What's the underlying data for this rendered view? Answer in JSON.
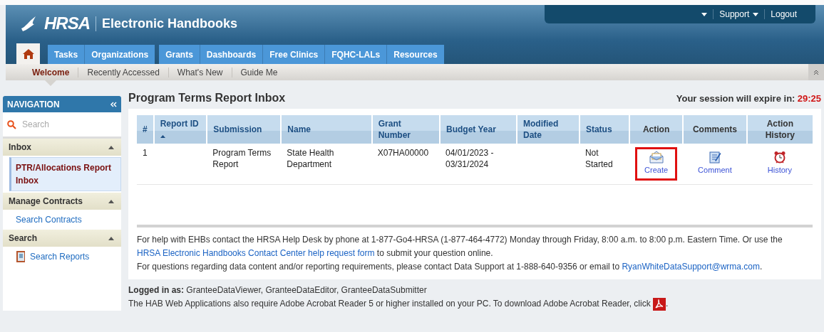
{
  "header": {
    "logo": "HRSA",
    "app_title": "Electronic Handbooks",
    "user_menu": [
      {
        "kind": "dropdown"
      },
      {
        "label": "Support",
        "kind": "dropdown"
      },
      {
        "label": "Logout",
        "kind": "link"
      }
    ]
  },
  "tabs": [
    {
      "kind": "home",
      "selected": true
    },
    {
      "label": "Tasks",
      "kind": "tab",
      "selected": false
    },
    {
      "label": "Organizations",
      "kind": "tab",
      "selected": false
    },
    {
      "label": "Grants",
      "kind": "tab",
      "selected": false
    },
    {
      "label": "Dashboards",
      "kind": "tab",
      "selected": false
    },
    {
      "label": "Free Clinics",
      "kind": "tab",
      "selected": false
    },
    {
      "label": "FQHC-LALs",
      "kind": "tab",
      "selected": false
    },
    {
      "label": "Resources",
      "kind": "tab",
      "selected": false
    }
  ],
  "subnav": [
    {
      "label": "Welcome",
      "selected": true
    },
    {
      "label": "Recently Accessed",
      "selected": false
    },
    {
      "label": "What's New",
      "selected": false
    },
    {
      "label": "Guide Me",
      "selected": false
    }
  ],
  "sidebar": {
    "title": "NAVIGATION",
    "search": {
      "placeholder": "Search"
    },
    "sections": [
      {
        "label": "Inbox",
        "expanded": true,
        "items": [
          {
            "label": "PTR/Allocations Report Inbox",
            "selected": true,
            "kind": "plain"
          }
        ]
      },
      {
        "label": "Manage Contracts",
        "expanded": true,
        "items": [
          {
            "label": "Search Contracts",
            "selected": false,
            "kind": "plain"
          }
        ]
      },
      {
        "label": "Search",
        "expanded": true,
        "items": [
          {
            "label": "Search Reports",
            "selected": false,
            "kind": "report"
          }
        ]
      }
    ]
  },
  "page": {
    "title": "Program Terms Report Inbox",
    "session_label": "Your session will expire in:",
    "session_time": "29:25"
  },
  "table": {
    "columns": [
      {
        "label": "#",
        "sorted": false
      },
      {
        "label": "Report ID",
        "sorted": true
      },
      {
        "label": "Submission",
        "sorted": false
      },
      {
        "label": "Name",
        "sorted": false
      },
      {
        "label": "Grant Number",
        "sorted": false
      },
      {
        "label": "Budget Year",
        "sorted": false
      },
      {
        "label": "Modified Date",
        "sorted": false
      },
      {
        "label": "Status",
        "sorted": false
      },
      {
        "label": "Action",
        "sorted": false
      },
      {
        "label": "Comments",
        "sorted": false
      },
      {
        "label": "Action History",
        "sorted": false
      }
    ],
    "rows": [
      {
        "cells": [
          {
            "kind": "text",
            "text": "1"
          },
          {
            "kind": "text",
            "text": ""
          },
          {
            "kind": "text",
            "text": "Program Terms Report"
          },
          {
            "kind": "text",
            "text": "State Health Department"
          },
          {
            "kind": "text",
            "text": "X07HA00000"
          },
          {
            "kind": "text",
            "text": "04/01/2023 - 03/31/2024"
          },
          {
            "kind": "text",
            "text": ""
          },
          {
            "kind": "text",
            "text": "Not Started"
          },
          {
            "kind": "action",
            "text": "Create",
            "highlighted": true
          },
          {
            "kind": "action",
            "text": "Comment",
            "highlighted": false
          },
          {
            "kind": "action",
            "text": "History",
            "highlighted": false
          }
        ]
      }
    ]
  },
  "help": [
    [
      {
        "kind": "text",
        "text": "For help with EHBs contact the HRSA Help Desk by phone at 1-877-Go4-HRSA (1-877-464-4772) Monday through Friday, 8:00 a.m. to 8:00 p.m. Eastern Time. Or use the "
      },
      {
        "kind": "link",
        "text": "HRSA Electronic Handbooks Contact Center help request form"
      },
      {
        "kind": "text",
        "text": " to submit your question online."
      }
    ],
    [
      {
        "kind": "text",
        "text": "For questions regarding data content and/or reporting requirements, please contact Data Support at 1-888-640-9356 or email to "
      },
      {
        "kind": "link",
        "text": "RyanWhiteDataSupport@wrma.com"
      },
      {
        "kind": "text",
        "text": "."
      }
    ]
  ],
  "footer": {
    "logged_in": "**Logged in as:** GranteeDataViewer, GranteeDataEditor, GranteeDataSubmitter",
    "reader_note": "The HAB Web Applications also require Adobe Acrobat Reader 5 or higher installed on your PC. To download Adobe Acrobat Reader, click",
    "reader_end": "."
  }
}
